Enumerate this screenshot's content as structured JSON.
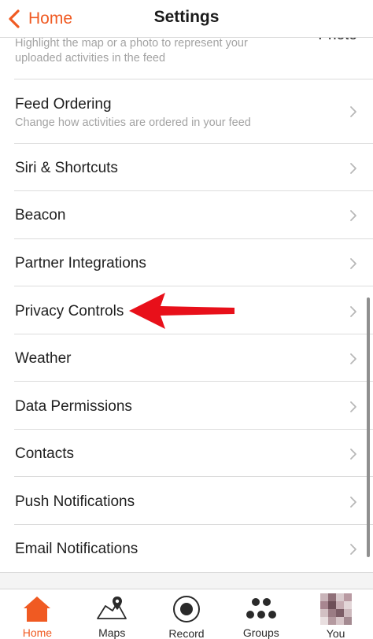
{
  "nav": {
    "back_label": "Home",
    "title": "Settings"
  },
  "rows": [
    {
      "subtitle": "Highlight the map or a photo to represent your uploaded activities in the feed",
      "subtitle_line1": "Highlight the map or a photo to represent your",
      "subtitle_line2": "uploaded activities in the feed",
      "value": "Photo"
    },
    {
      "title": "Feed Ordering",
      "subtitle": "Change how activities are ordered in your feed"
    },
    {
      "title": "Siri & Shortcuts"
    },
    {
      "title": "Beacon"
    },
    {
      "title": "Partner Integrations"
    },
    {
      "title": "Privacy Controls"
    },
    {
      "title": "Weather"
    },
    {
      "title": "Data Permissions"
    },
    {
      "title": "Contacts"
    },
    {
      "title": "Push Notifications"
    },
    {
      "title": "Email Notifications"
    }
  ],
  "tabs": [
    {
      "label": "Home",
      "icon": "home-icon",
      "active": true
    },
    {
      "label": "Maps",
      "icon": "map-icon",
      "active": false
    },
    {
      "label": "Record",
      "icon": "record-icon",
      "active": false
    },
    {
      "label": "Groups",
      "icon": "groups-icon",
      "active": false
    },
    {
      "label": "You",
      "icon": "avatar",
      "active": false
    }
  ],
  "colors": {
    "accent": "#f05a22",
    "arrow": "#e8101a",
    "separator": "#dcdcdc",
    "subtitle": "#a3a3a3"
  }
}
